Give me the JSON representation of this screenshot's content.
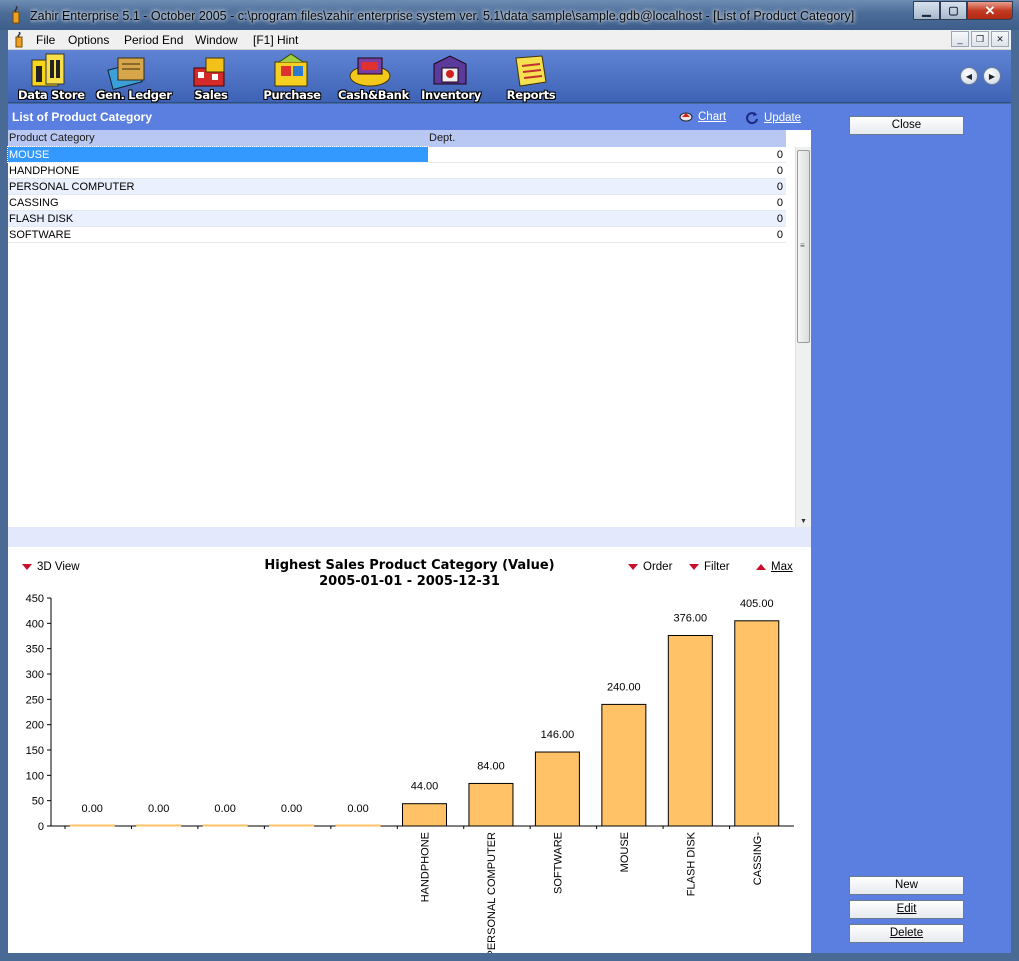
{
  "window": {
    "title": "Zahir Enterprise 5.1 - October 2005 - c:\\program files\\zahir enterprise system ver. 5.1\\data sample\\sample.gdb@localhost - [List of Product Category]",
    "minimize": "▁",
    "maximize": "▢",
    "close": "✕"
  },
  "menu": {
    "items": [
      "File",
      "Options",
      "Period End",
      "Window",
      "[F1] Hint"
    ]
  },
  "toolbar": {
    "buttons": [
      "Data Store",
      "Gen. Ledger",
      "Sales",
      "Purchase",
      "Cash&Bank",
      "Inventory",
      "Reports"
    ]
  },
  "list": {
    "title": "List of Product Category",
    "chart_label": "Chart",
    "update_label": "Update",
    "columns": [
      "Product Category",
      "Dept."
    ],
    "rows": [
      {
        "category": "MOUSE",
        "dept": "0"
      },
      {
        "category": "HANDPHONE",
        "dept": "0"
      },
      {
        "category": "PERSONAL COMPUTER",
        "dept": "0"
      },
      {
        "category": "CASSING",
        "dept": "0"
      },
      {
        "category": "FLASH DISK",
        "dept": "0"
      },
      {
        "category": "SOFTWARE",
        "dept": "0"
      }
    ]
  },
  "side": {
    "close": "Close",
    "new": "New",
    "edit": "Edit",
    "delete": "Delete"
  },
  "chart_controls": {
    "view3d": "3D View",
    "order": "Order",
    "filter": "Filter",
    "max": "Max"
  },
  "colors": {
    "bar_fill": "#ffc266",
    "bar_stroke": "#000000",
    "panel_blue": "#5b7fe0"
  },
  "chart_data": {
    "type": "bar",
    "title": "Highest Sales Product Category (Value)",
    "subtitle": "2005-01-01 - 2005-12-31",
    "categories": [
      "",
      "",
      "",
      "",
      "",
      "HANDPHONE",
      "PERSONAL COMPUTER",
      "SOFTWARE",
      "MOUSE",
      "FLASH DISK",
      "CASSING"
    ],
    "values": [
      0,
      0,
      0,
      0,
      0,
      44,
      84,
      146,
      240,
      376,
      405
    ],
    "value_labels": [
      "0.00",
      "0.00",
      "0.00",
      "0.00",
      "0.00",
      "44.00",
      "84.00",
      "146.00",
      "240.00",
      "376.00",
      "405.00"
    ],
    "ylim": [
      0,
      450
    ],
    "yticks": [
      0,
      50,
      100,
      150,
      200,
      250,
      300,
      350,
      400,
      450
    ],
    "grid": false,
    "legend": "none"
  }
}
